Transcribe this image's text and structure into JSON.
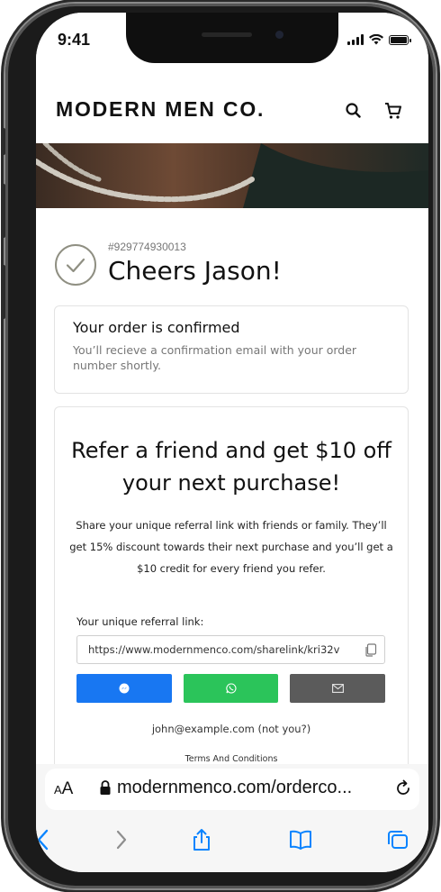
{
  "status": {
    "time": "9:41"
  },
  "header": {
    "brand": "MODERN MEN CO."
  },
  "order": {
    "number": "#929774930013",
    "greeting": "Cheers Jason!",
    "confirm_title": "Your order is confirmed",
    "confirm_text": "You’ll recieve a confirmation email with your order number shortly."
  },
  "referral": {
    "title": "Refer a friend and get $10 off your next purchase!",
    "description": "Share your unique referral link with friends or family. They’ll get 15% discount towards their next purchase and you’ll get a $10 credit for every friend you refer.",
    "link_label": "Your unique referral link:",
    "link_value": "https://www.modernmenco.com/sharelink/kri32v",
    "not_you": "john@example.com (not you?)",
    "terms": "Terms And Conditions"
  },
  "colors": {
    "messenger": "#1877f2",
    "whatsapp": "#2bc45a",
    "email": "#5b5b5b",
    "ios_blue": "#0a84ff"
  },
  "icons": {
    "search": "search-icon",
    "cart": "cart-icon",
    "check": "check-circle-icon",
    "copy": "copy-icon",
    "messenger": "messenger-icon",
    "whatsapp": "whatsapp-icon",
    "email": "email-icon",
    "back": "chevron-left-icon",
    "forward": "chevron-right-icon",
    "share": "share-icon",
    "bookmarks": "book-icon",
    "tabs": "tabs-icon"
  },
  "browser": {
    "aa_small": "A",
    "aa_big": "A",
    "url": "modernmenco.com/orderco..."
  }
}
